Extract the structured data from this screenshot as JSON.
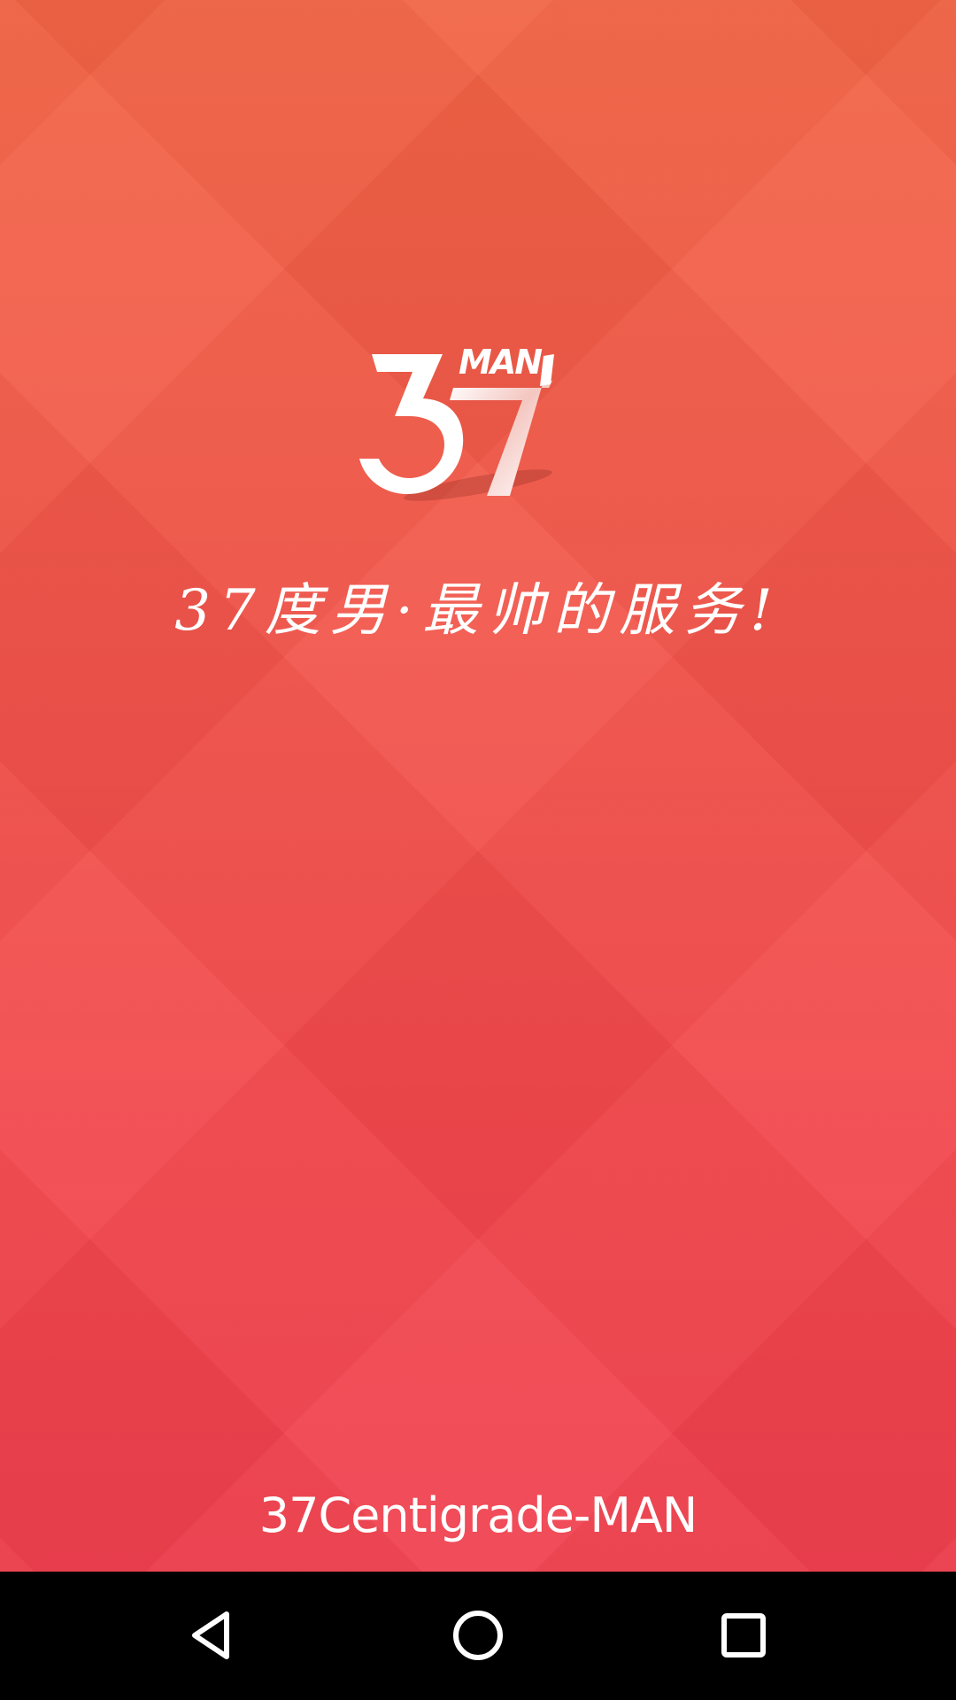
{
  "splash": {
    "logo": {
      "number_text": "37",
      "wordmark_text": "MAN"
    },
    "slogan": "37度男·最帅的服务!",
    "brand_name": "37Centigrade-MAN"
  },
  "navigation_bar": {
    "back_icon": "back-triangle-icon",
    "home_icon": "home-circle-icon",
    "recent_icon": "recent-apps-square-icon"
  },
  "colors": {
    "background_top": "#f26444",
    "background_bottom": "#f03f4e",
    "text": "#ffffff",
    "navbar": "#000000"
  }
}
